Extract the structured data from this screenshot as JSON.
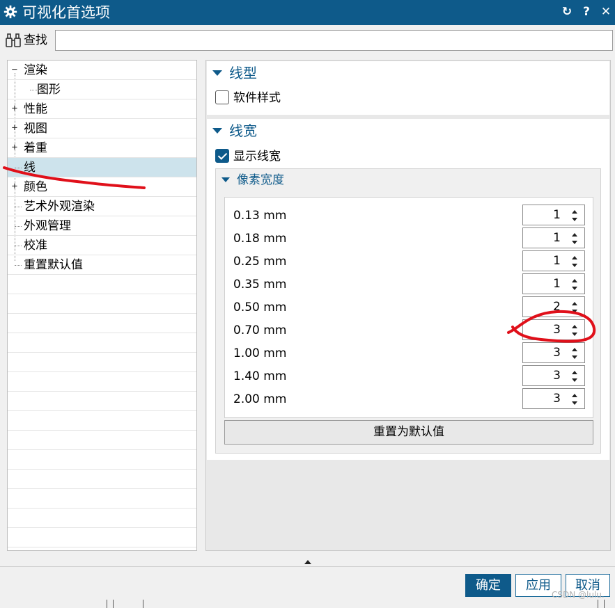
{
  "window": {
    "title": "可视化首选项",
    "buttons": {
      "reset": "↻",
      "help": "?",
      "close": "✕"
    }
  },
  "find": {
    "label": "查找",
    "value": ""
  },
  "tree": {
    "items": [
      {
        "label": "渲染",
        "expander": "−"
      },
      {
        "label": "图形",
        "expander": ""
      },
      {
        "label": "性能",
        "expander": "+"
      },
      {
        "label": "视图",
        "expander": "+"
      },
      {
        "label": "着重",
        "expander": "+"
      },
      {
        "label": "线",
        "expander": "",
        "selected": true
      },
      {
        "label": "颜色",
        "expander": "+"
      },
      {
        "label": "艺术外观渲染",
        "expander": ""
      },
      {
        "label": "外观管理",
        "expander": ""
      },
      {
        "label": "校准",
        "expander": ""
      },
      {
        "label": "重置默认值",
        "expander": ""
      }
    ]
  },
  "linetype": {
    "header": "线型",
    "software_style": {
      "label": "软件样式",
      "checked": false
    }
  },
  "linewidth": {
    "header": "线宽",
    "show_widths": {
      "label": "显示线宽",
      "checked": true
    },
    "pixel_width": {
      "header": "像素宽度",
      "rows": [
        {
          "label": "0.13 mm",
          "value": "1"
        },
        {
          "label": "0.18 mm",
          "value": "1"
        },
        {
          "label": "0.25 mm",
          "value": "1"
        },
        {
          "label": "0.35 mm",
          "value": "1"
        },
        {
          "label": "0.50 mm",
          "value": "2"
        },
        {
          "label": "0.70 mm",
          "value": "3"
        },
        {
          "label": "1.00 mm",
          "value": "3"
        },
        {
          "label": "1.40 mm",
          "value": "3"
        },
        {
          "label": "2.00 mm",
          "value": "3"
        }
      ],
      "reset_label": "重置为默认值"
    }
  },
  "footer": {
    "ok": "确定",
    "apply": "应用",
    "cancel": "取消"
  },
  "watermark": "CSDN @lulu.",
  "colors": {
    "accent": "#0e5a8a",
    "annotation": "#e0101a",
    "selection": "#cde3ec"
  }
}
